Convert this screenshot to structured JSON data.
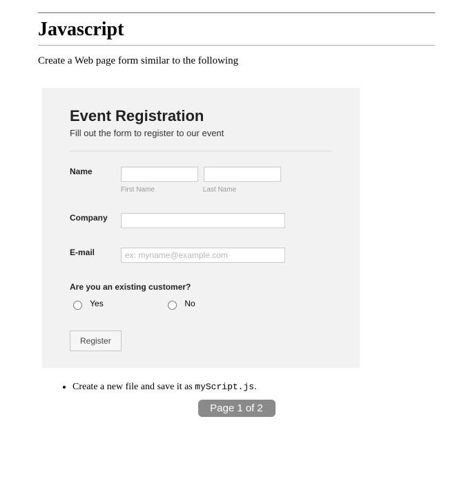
{
  "header": {
    "title": "Javascript"
  },
  "intro": "Create a Web page form similar to the following",
  "form": {
    "heading": "Event Registration",
    "subheading": "Fill out the form to register to our event",
    "name": {
      "label": "Name",
      "first_value": "",
      "last_value": "",
      "first_sublabel": "First Name",
      "last_sublabel": "Last Name"
    },
    "company": {
      "label": "Company",
      "value": ""
    },
    "email": {
      "label": "E-mail",
      "value": "",
      "placeholder": "ex: myname@example.com"
    },
    "customer_question": {
      "label": "Are you an existing customer?",
      "yes": "Yes",
      "no": "No"
    },
    "submit_label": "Register"
  },
  "steps": {
    "item1_prefix": "Create a new file and save it as ",
    "item1_code": "myScript.js",
    "item1_suffix": "."
  },
  "footer": {
    "page_indicator": "Page 1 of 2"
  }
}
